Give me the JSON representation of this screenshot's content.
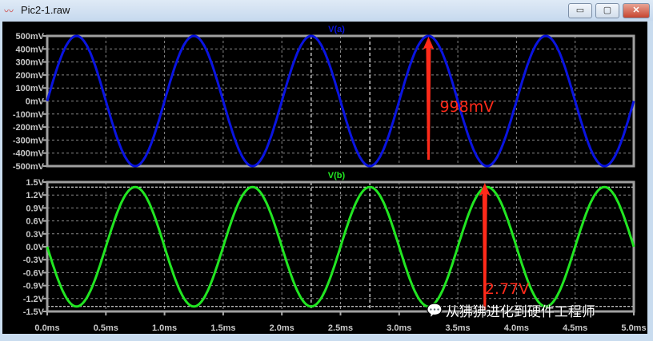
{
  "window": {
    "title": "Pic2-1.raw",
    "icon": "waveform-icon",
    "minimize": "▭",
    "restore": "▢",
    "close": "✕"
  },
  "watermark": {
    "icon": "wechat-icon",
    "text": "从狒狒进化到硬件工程师"
  },
  "chart_data": [
    {
      "type": "line",
      "title": "V(a)",
      "series": [
        {
          "name": "V(a)",
          "color": "#0a14e0",
          "function": "sine",
          "amplitude_mV": 500,
          "period_ms": 1,
          "phase": "starts at 0 rising"
        }
      ],
      "yticks": [
        "500mV",
        "400mV",
        "300mV",
        "200mV",
        "100mV",
        "0mV",
        "-100mV",
        "-200mV",
        "-300mV",
        "-400mV",
        "-500mV"
      ],
      "ylim": [
        -500,
        500
      ],
      "yunit": "mV",
      "annotation": {
        "text": "998mV",
        "x_ms": 3.25,
        "color": "#ff2a1a"
      },
      "cursors_ms": [
        2.25,
        2.75
      ],
      "grid": true
    },
    {
      "type": "line",
      "title": "V(b)",
      "series": [
        {
          "name": "V(b)",
          "color": "#22e622",
          "function": "sine",
          "amplitude_V": 1.385,
          "period_ms": 1,
          "phase": "starts at 0 falling"
        }
      ],
      "yticks": [
        "1.5V",
        "1.2V",
        "0.9V",
        "0.6V",
        "0.3V",
        "0.0V",
        "-0.3V",
        "-0.6V",
        "-0.9V",
        "-1.2V",
        "-1.5V"
      ],
      "ylim": [
        -1.5,
        1.5
      ],
      "yunit": "V",
      "annotation": {
        "text": "2.77V",
        "x_ms": 3.73,
        "color": "#ff2a1a"
      },
      "cursors_ms": [
        2.25,
        2.75
      ],
      "hlines": [
        1.385,
        -1.385
      ],
      "grid": true
    }
  ],
  "xaxis": {
    "ticks": [
      "0.0ms",
      "0.5ms",
      "1.0ms",
      "1.5ms",
      "2.0ms",
      "2.5ms",
      "3.0ms",
      "3.5ms",
      "4.0ms",
      "4.5ms",
      "5.0ms"
    ],
    "xlim": [
      0,
      5
    ]
  }
}
